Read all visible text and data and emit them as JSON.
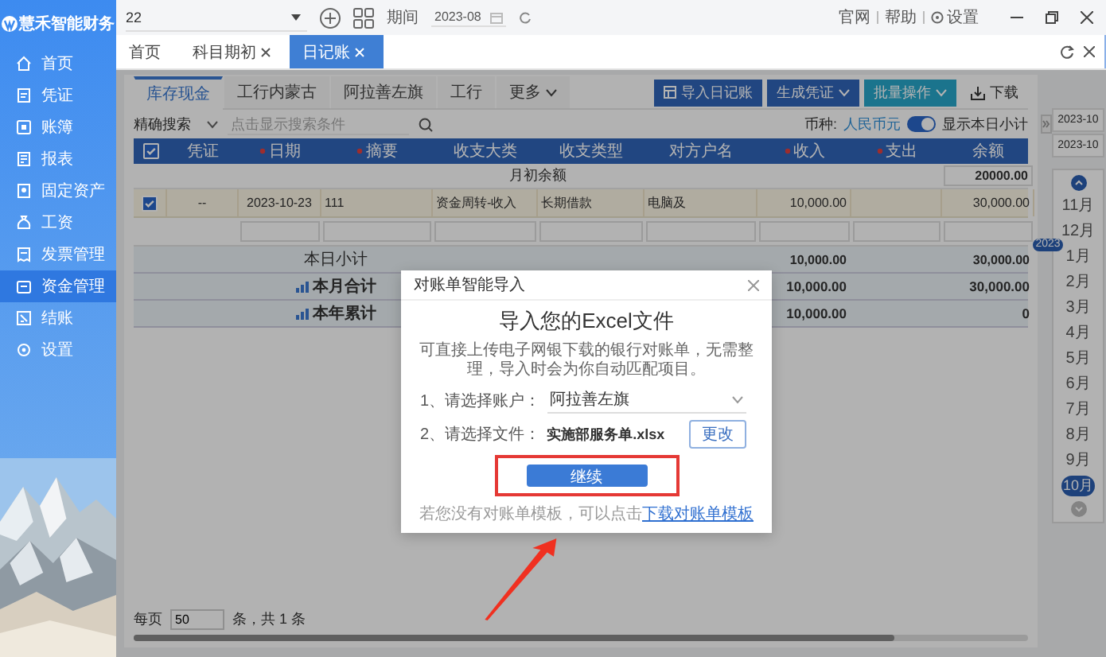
{
  "sidebar": {
    "logo_text": "慧禾智能财务",
    "items": [
      {
        "label": "首页",
        "selected": false
      },
      {
        "label": "凭证",
        "selected": false
      },
      {
        "label": "账簿",
        "selected": false
      },
      {
        "label": "报表",
        "selected": false
      },
      {
        "label": "固定资产",
        "selected": false
      },
      {
        "label": "工资",
        "selected": false
      },
      {
        "label": "发票管理",
        "selected": false
      },
      {
        "label": "资金管理",
        "selected": true
      },
      {
        "label": "结账",
        "selected": false
      },
      {
        "label": "设置",
        "selected": false
      }
    ]
  },
  "top_bar": {
    "company": "22",
    "period_label": "期间",
    "period": "2023-08",
    "links": [
      "官网",
      "帮助",
      "设置"
    ]
  },
  "page_tabs": [
    {
      "label": "首页",
      "closable": false,
      "selected": false
    },
    {
      "label": "科目期初",
      "closable": true,
      "selected": false
    },
    {
      "label": "日记账",
      "closable": true,
      "selected": true
    }
  ],
  "account_tabs": [
    {
      "label": "库存现金",
      "kind": "tab",
      "selected": true
    },
    {
      "label": "工行内蒙古",
      "kind": "tab",
      "selected": false
    },
    {
      "label": "阿拉善左旗",
      "kind": "tab",
      "selected": false
    },
    {
      "label": "工行",
      "kind": "tab",
      "selected": false
    },
    {
      "label": "更多",
      "kind": "menu",
      "selected": false
    }
  ],
  "toolbar": [
    {
      "label": "导入日记账",
      "kind": "import"
    },
    {
      "label": "生成凭证",
      "kind": "dropdown"
    },
    {
      "label": "批量操作",
      "kind": "dropdown-teal"
    },
    {
      "label": "下载",
      "kind": "download"
    }
  ],
  "filter": {
    "mode": "精确搜索",
    "placeholder": "点击显示搜索条件",
    "currency_label": "币种:",
    "currency": "人民币元",
    "subtotal_toggle": {
      "label": "显示本日小计",
      "on": true
    }
  },
  "table": {
    "all_checked": true,
    "columns": [
      {
        "label": "凭证",
        "required": false
      },
      {
        "label": "日期",
        "required": true
      },
      {
        "label": "摘要",
        "required": true
      },
      {
        "label": "收支大类",
        "required": false
      },
      {
        "label": "收支类型",
        "required": false
      },
      {
        "label": "对方户名",
        "required": false
      },
      {
        "label": "收入",
        "required": true
      },
      {
        "label": "支出",
        "required": true
      },
      {
        "label": "余额",
        "required": false
      }
    ],
    "opening": {
      "label": "月初余额",
      "balance": "20000.00"
    },
    "rows": [
      {
        "checked": true,
        "cells": [
          "--",
          "2023-10-23",
          "111",
          "资金周转-收入",
          "长期借款",
          "电脑及",
          "10,000.00",
          "",
          "30,000.00"
        ]
      }
    ],
    "totals": [
      {
        "label": "本日小计",
        "kind": "plain",
        "income": "10,000.00",
        "balance": "30,000.00"
      },
      {
        "label": "本月合计",
        "kind": "chart",
        "income": "10,000.00",
        "balance": "30,000.00"
      },
      {
        "label": "本年累计",
        "kind": "chart",
        "income": "10,000.00",
        "balance": "0"
      }
    ]
  },
  "pagination": {
    "per_page_label": "每页",
    "per_page": "50",
    "total": "条，共 1 条"
  },
  "date_panel": {
    "dates": [
      "2023-10",
      "2023-10"
    ],
    "months": [
      {
        "label": "11月",
        "selected": false
      },
      {
        "label": "12月",
        "selected": false
      },
      {
        "label": "1月",
        "year": "2023",
        "selected": false
      },
      {
        "label": "2月",
        "selected": false
      },
      {
        "label": "3月",
        "selected": false
      },
      {
        "label": "4月",
        "selected": false
      },
      {
        "label": "5月",
        "selected": false
      },
      {
        "label": "6月",
        "selected": false
      },
      {
        "label": "7月",
        "selected": false
      },
      {
        "label": "8月",
        "selected": false
      },
      {
        "label": "9月",
        "selected": false
      },
      {
        "label": "10月",
        "selected": true
      }
    ]
  },
  "modal": {
    "title": "对账单智能导入",
    "heading": "导入您的Excel文件",
    "description": "可直接上传电子网银下载的银行对账单，无需整理，导入时会为你自动匹配项目。",
    "account_label": "1、请选择账户：",
    "account": "阿拉善左旗",
    "file_label": "2、请选择文件：",
    "file": "实施部服务单.xlsx",
    "change_button": "更改",
    "continue_button": "继续",
    "footer_text": "若您没有对账单模板，可以点击",
    "footer_link": "下载对账单模板"
  }
}
